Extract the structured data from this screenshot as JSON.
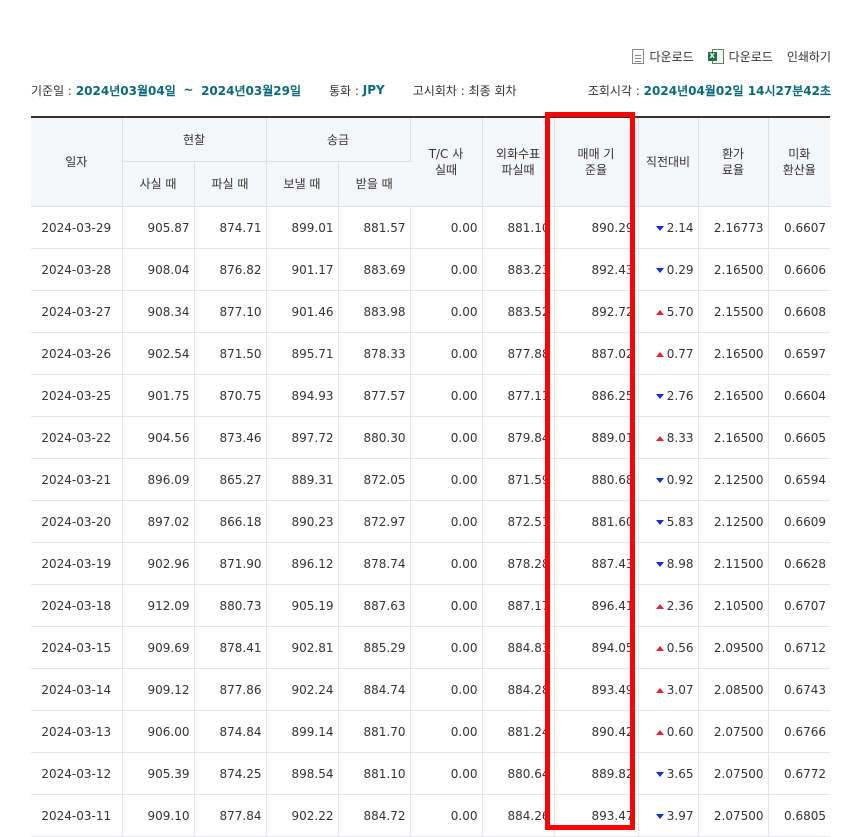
{
  "toolbar": {
    "download_label": "다운로드",
    "excel_download_label": "다운로드",
    "print_label": "인쇄하기"
  },
  "info": {
    "base_date_label": "기준일 :",
    "start_date": "2024년03월04일",
    "tilde": "~",
    "end_date": "2024년03월29일",
    "currency_label": "통화 :",
    "currency": "JPY",
    "notice_label": "고시회차 :",
    "notice_value": "최종 회차",
    "query_time_label": "조회시각 :",
    "query_time": "2024년04월02일 14시27분42초"
  },
  "headers": {
    "date": "일자",
    "cash": "현찰",
    "cash_buy": "사실 때",
    "cash_sell": "파실 때",
    "remit": "송금",
    "remit_send": "보낼 때",
    "remit_receive": "받을 때",
    "tc": "T/C 사실때",
    "check": "외화수표 파실때",
    "base_rate": "매매 기준율",
    "change": "직전대비",
    "fee_rate": "환가 료율",
    "usd_rate": "미화 환산율"
  },
  "rows": [
    {
      "date": "2024-03-29",
      "cash_buy": "905.87",
      "cash_sell": "874.71",
      "send": "899.01",
      "receive": "881.57",
      "tc": "0.00",
      "check": "881.10",
      "base": "890.29",
      "dir": "down",
      "change": "2.14",
      "fee": "2.16773",
      "usd": "0.6607"
    },
    {
      "date": "2024-03-28",
      "cash_buy": "908.04",
      "cash_sell": "876.82",
      "send": "901.17",
      "receive": "883.69",
      "tc": "0.00",
      "check": "883.23",
      "base": "892.43",
      "dir": "down",
      "change": "0.29",
      "fee": "2.16500",
      "usd": "0.6606"
    },
    {
      "date": "2024-03-27",
      "cash_buy": "908.34",
      "cash_sell": "877.10",
      "send": "901.46",
      "receive": "883.98",
      "tc": "0.00",
      "check": "883.52",
      "base": "892.72",
      "dir": "up",
      "change": "5.70",
      "fee": "2.15500",
      "usd": "0.6608"
    },
    {
      "date": "2024-03-26",
      "cash_buy": "902.54",
      "cash_sell": "871.50",
      "send": "895.71",
      "receive": "878.33",
      "tc": "0.00",
      "check": "877.88",
      "base": "887.02",
      "dir": "up",
      "change": "0.77",
      "fee": "2.16500",
      "usd": "0.6597"
    },
    {
      "date": "2024-03-25",
      "cash_buy": "901.75",
      "cash_sell": "870.75",
      "send": "894.93",
      "receive": "877.57",
      "tc": "0.00",
      "check": "877.11",
      "base": "886.25",
      "dir": "down",
      "change": "2.76",
      "fee": "2.16500",
      "usd": "0.6604"
    },
    {
      "date": "2024-03-22",
      "cash_buy": "904.56",
      "cash_sell": "873.46",
      "send": "897.72",
      "receive": "880.30",
      "tc": "0.00",
      "check": "879.84",
      "base": "889.01",
      "dir": "up",
      "change": "8.33",
      "fee": "2.16500",
      "usd": "0.6605"
    },
    {
      "date": "2024-03-21",
      "cash_buy": "896.09",
      "cash_sell": "865.27",
      "send": "889.31",
      "receive": "872.05",
      "tc": "0.00",
      "check": "871.59",
      "base": "880.68",
      "dir": "down",
      "change": "0.92",
      "fee": "2.12500",
      "usd": "0.6594"
    },
    {
      "date": "2024-03-20",
      "cash_buy": "897.02",
      "cash_sell": "866.18",
      "send": "890.23",
      "receive": "872.97",
      "tc": "0.00",
      "check": "872.51",
      "base": "881.60",
      "dir": "down",
      "change": "5.83",
      "fee": "2.12500",
      "usd": "0.6609"
    },
    {
      "date": "2024-03-19",
      "cash_buy": "902.96",
      "cash_sell": "871.90",
      "send": "896.12",
      "receive": "878.74",
      "tc": "0.00",
      "check": "878.28",
      "base": "887.43",
      "dir": "down",
      "change": "8.98",
      "fee": "2.11500",
      "usd": "0.6628"
    },
    {
      "date": "2024-03-18",
      "cash_buy": "912.09",
      "cash_sell": "880.73",
      "send": "905.19",
      "receive": "887.63",
      "tc": "0.00",
      "check": "887.17",
      "base": "896.41",
      "dir": "up",
      "change": "2.36",
      "fee": "2.10500",
      "usd": "0.6707"
    },
    {
      "date": "2024-03-15",
      "cash_buy": "909.69",
      "cash_sell": "878.41",
      "send": "902.81",
      "receive": "885.29",
      "tc": "0.00",
      "check": "884.83",
      "base": "894.05",
      "dir": "up",
      "change": "0.56",
      "fee": "2.09500",
      "usd": "0.6712"
    },
    {
      "date": "2024-03-14",
      "cash_buy": "909.12",
      "cash_sell": "877.86",
      "send": "902.24",
      "receive": "884.74",
      "tc": "0.00",
      "check": "884.28",
      "base": "893.49",
      "dir": "up",
      "change": "3.07",
      "fee": "2.08500",
      "usd": "0.6743"
    },
    {
      "date": "2024-03-13",
      "cash_buy": "906.00",
      "cash_sell": "874.84",
      "send": "899.14",
      "receive": "881.70",
      "tc": "0.00",
      "check": "881.24",
      "base": "890.42",
      "dir": "up",
      "change": "0.60",
      "fee": "2.07500",
      "usd": "0.6766"
    },
    {
      "date": "2024-03-12",
      "cash_buy": "905.39",
      "cash_sell": "874.25",
      "send": "898.54",
      "receive": "881.10",
      "tc": "0.00",
      "check": "880.64",
      "base": "889.82",
      "dir": "down",
      "change": "3.65",
      "fee": "2.07500",
      "usd": "0.6772"
    },
    {
      "date": "2024-03-11",
      "cash_buy": "909.10",
      "cash_sell": "877.84",
      "send": "902.22",
      "receive": "884.72",
      "tc": "0.00",
      "check": "884.26",
      "base": "893.47",
      "dir": "down",
      "change": "3.97",
      "fee": "2.07500",
      "usd": "0.6805"
    }
  ],
  "colors": {
    "accent_teal": "#0b6a77",
    "down_blue": "#1a2ed6",
    "up_red": "#e0223b",
    "highlight_red": "#ff0000"
  }
}
